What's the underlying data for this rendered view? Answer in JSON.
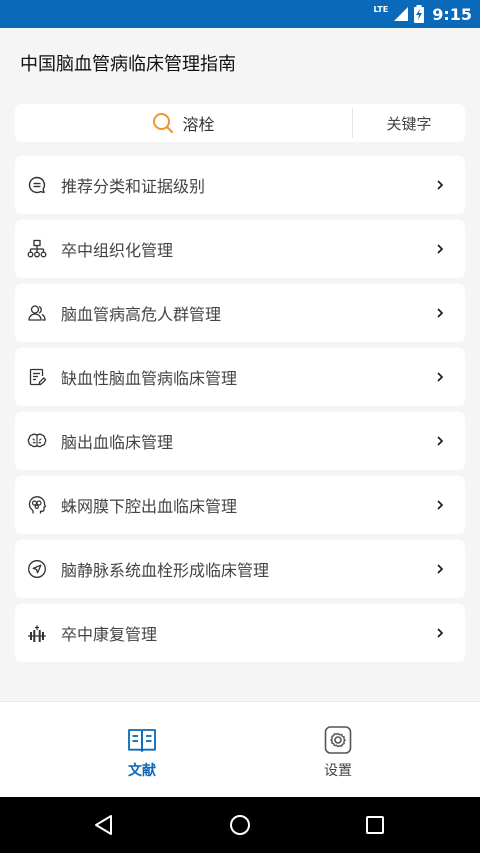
{
  "status_bar": {
    "network": "LTE",
    "time": "9:15"
  },
  "header": {
    "title": "中国脑血管病临床管理指南"
  },
  "search": {
    "query": "溶栓",
    "keyword_button": "关键字"
  },
  "menu": {
    "items": [
      {
        "label": "推荐分类和证据级别",
        "icon": "message-icon"
      },
      {
        "label": "卒中组织化管理",
        "icon": "org-chart-icon"
      },
      {
        "label": "脑血管病高危人群管理",
        "icon": "group-icon"
      },
      {
        "label": "缺血性脑血管病临床管理",
        "icon": "document-edit-icon"
      },
      {
        "label": "脑出血临床管理",
        "icon": "brain-icon"
      },
      {
        "label": "蛛网膜下腔出血临床管理",
        "icon": "head-gears-icon"
      },
      {
        "label": "脑静脉系统血栓形成临床管理",
        "icon": "navigation-icon"
      },
      {
        "label": "卒中康复管理",
        "icon": "dumbbell-icon"
      }
    ]
  },
  "bottom_nav": {
    "tabs": [
      {
        "label": "文献",
        "icon": "book-icon",
        "active": true
      },
      {
        "label": "设置",
        "icon": "settings-icon",
        "active": false
      }
    ]
  },
  "colors": {
    "primary": "#0a69b8",
    "search_icon": "#f0962c"
  }
}
